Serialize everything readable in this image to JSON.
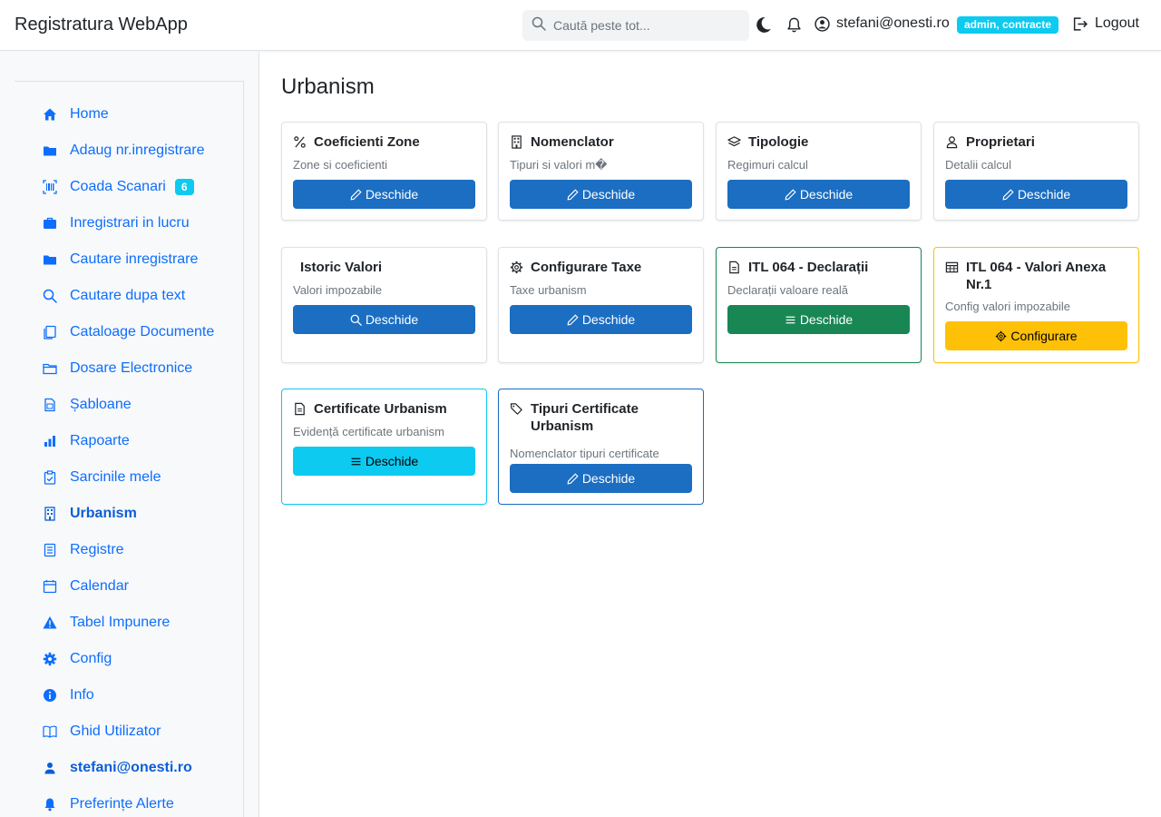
{
  "navbar": {
    "brand": "Registratura WebApp",
    "search_placeholder": "Caută peste tot...",
    "user_email": "stefani@onesti.ro",
    "role_badge": "admin, contracte",
    "logout_label": "Logout"
  },
  "sidebar": {
    "items": [
      {
        "label": "Home",
        "icon": "home-icon"
      },
      {
        "label": "Adaug nr.inregistrare",
        "icon": "folder-icon"
      },
      {
        "label": "Coada Scanari",
        "icon": "barcode-icon",
        "badge": "6"
      },
      {
        "label": "Inregistrari in lucru",
        "icon": "briefcase-icon"
      },
      {
        "label": "Cautare inregistrare",
        "icon": "folder-icon"
      },
      {
        "label": "Cautare dupa text",
        "icon": "search-icon"
      },
      {
        "label": "Cataloage Documente",
        "icon": "documents-icon"
      },
      {
        "label": "Dosare Electronice",
        "icon": "folder-outline-icon"
      },
      {
        "label": "Șabloane",
        "icon": "template-icon"
      },
      {
        "label": "Rapoarte",
        "icon": "bar-chart-icon"
      },
      {
        "label": "Sarcinile mele",
        "icon": "clipboard-check-icon"
      },
      {
        "label": "Urbanism",
        "icon": "building-icon",
        "active": true
      },
      {
        "label": "Registre",
        "icon": "register-icon"
      },
      {
        "label": "Calendar",
        "icon": "calendar-icon"
      },
      {
        "label": "Tabel Impunere",
        "icon": "warning-icon"
      },
      {
        "label": "Config",
        "icon": "gear-icon"
      },
      {
        "label": "Info",
        "icon": "info-icon"
      },
      {
        "label": "Ghid Utilizator",
        "icon": "book-icon"
      },
      {
        "label": "stefani@onesti.ro",
        "icon": "person-icon",
        "active": true
      },
      {
        "label": "Preferințe Alerte",
        "icon": "bell-icon"
      }
    ]
  },
  "main": {
    "title": "Urbanism",
    "cards": [
      {
        "title": "Coeficienti Zone",
        "desc": "Zone si coeficienti",
        "button": "Deschide",
        "icon": "percent-icon",
        "button_icon": "pencil-icon",
        "variant": "primary"
      },
      {
        "title": "Nomenclator",
        "desc": "Tipuri si valori m�",
        "button": "Deschide",
        "icon": "building-icon",
        "button_icon": "pencil-icon",
        "variant": "primary"
      },
      {
        "title": "Tipologie",
        "desc": "Regimuri calcul",
        "button": "Deschide",
        "icon": "layers-icon",
        "button_icon": "pencil-icon",
        "variant": "primary"
      },
      {
        "title": "Proprietari",
        "desc": "Detalii calcul",
        "button": "Deschide",
        "icon": "person-icon",
        "button_icon": "pencil-icon",
        "variant": "primary"
      },
      {
        "title": "Istoric Valori",
        "desc": "Valori impozabile",
        "button": "Deschide",
        "icon": "",
        "button_icon": "search-icon",
        "variant": "primary"
      },
      {
        "title": "Configurare Taxe",
        "desc": "Taxe urbanism",
        "button": "Deschide",
        "icon": "gear-icon",
        "button_icon": "pencil-icon",
        "variant": "primary"
      },
      {
        "title": "ITL 064 - Declarații",
        "desc": "Declarații valoare reală",
        "button": "Deschide",
        "icon": "document-icon",
        "button_icon": "list-icon",
        "variant": "success"
      },
      {
        "title": "ITL 064 - Valori Anexa Nr.1",
        "desc": "Config valori impozabile",
        "button": "Configurare",
        "icon": "table-icon",
        "button_icon": "gear-icon",
        "variant": "warning"
      },
      {
        "title": "Certificate Urbanism",
        "desc": "Evidență certificate urbanism",
        "button": "Deschide",
        "icon": "document-icon",
        "button_icon": "list-icon",
        "variant": "info"
      },
      {
        "title": "Tipuri Certificate Urbanism",
        "desc": "Nomenclator tipuri certificate",
        "button": "Deschide",
        "icon": "tags-icon",
        "button_icon": "pencil-icon",
        "variant": "primary"
      }
    ]
  },
  "colors": {
    "primary": "#1b6ec2",
    "success": "#198754",
    "warning": "#ffc107",
    "info": "#0dcaf0",
    "link": "#0d6efd"
  }
}
